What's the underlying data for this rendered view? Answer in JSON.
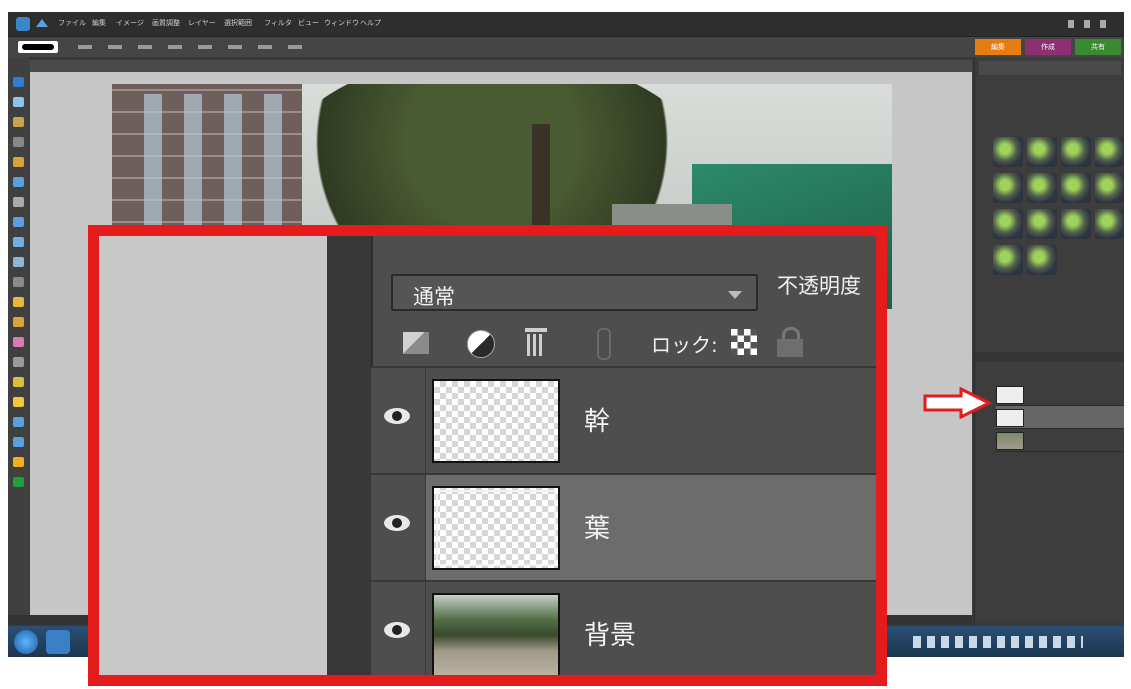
{
  "menu": [
    "ファイル",
    "編集",
    "イメージ",
    "画質調整",
    "レイヤー",
    "選択範囲",
    "フィルタ",
    "ビュー",
    "ウィンドウ",
    "ヘルプ"
  ],
  "mode_tabs": [
    "編集",
    "作成",
    "共有"
  ],
  "colors": {
    "highlight": "#e61b1b",
    "panel": "#4e4e4e",
    "selected_row": "#6c6c6c"
  },
  "zoom": {
    "blend_mode": "通常",
    "opacity_label": "不透明度",
    "lock_label": "ロック:",
    "icons": [
      "new-layer-icon",
      "adjustment-layer-icon",
      "trash-icon",
      "link-icon",
      "lock-transparency-icon",
      "lock-icon"
    ],
    "layers": [
      {
        "name": "幹",
        "visible": true,
        "selected": false,
        "type": "transparent"
      },
      {
        "name": "葉",
        "visible": true,
        "selected": true,
        "type": "transparent"
      },
      {
        "name": "背景",
        "visible": true,
        "selected": false,
        "type": "photo"
      }
    ]
  }
}
